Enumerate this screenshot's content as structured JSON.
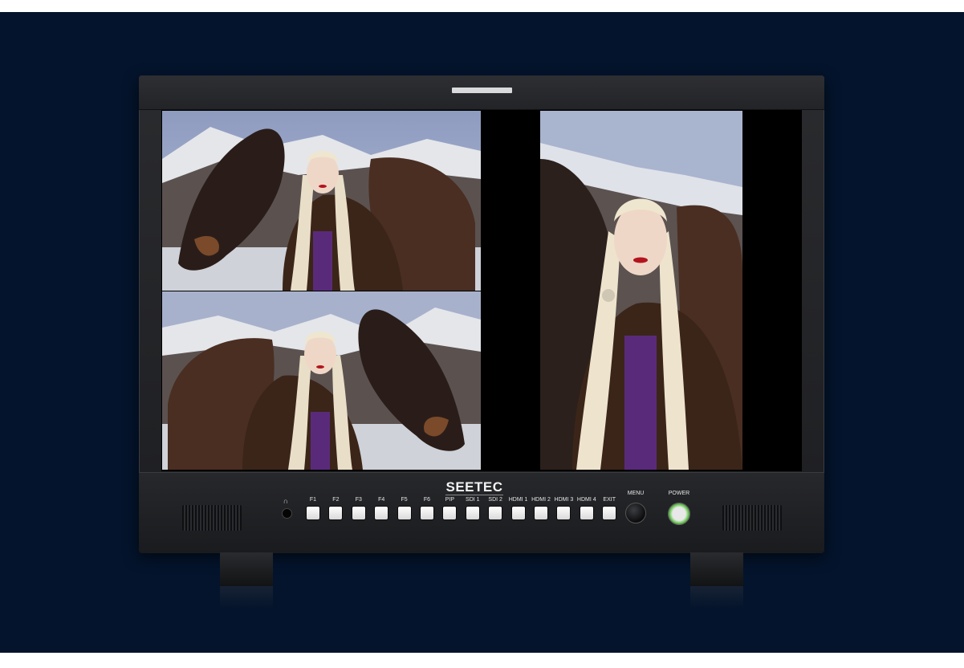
{
  "monitor": {
    "brand": "SEETEC",
    "headphone_symbol": "∩"
  },
  "buttons": [
    {
      "label": "F1"
    },
    {
      "label": "F2"
    },
    {
      "label": "F3"
    },
    {
      "label": "F4"
    },
    {
      "label": "F5"
    },
    {
      "label": "F6"
    },
    {
      "label": "PIP"
    },
    {
      "label": "SDI 1"
    },
    {
      "label": "SDI 2"
    },
    {
      "label": "HDMI 1"
    },
    {
      "label": "HDMI 2"
    },
    {
      "label": "HDMI 3"
    },
    {
      "label": "HDMI 4"
    },
    {
      "label": "EXIT"
    }
  ],
  "menu_label": "MENU",
  "power_label": "POWER",
  "colors": {
    "background": "#04142c",
    "bezel": "#232427",
    "power_led": "#4ca83a"
  }
}
